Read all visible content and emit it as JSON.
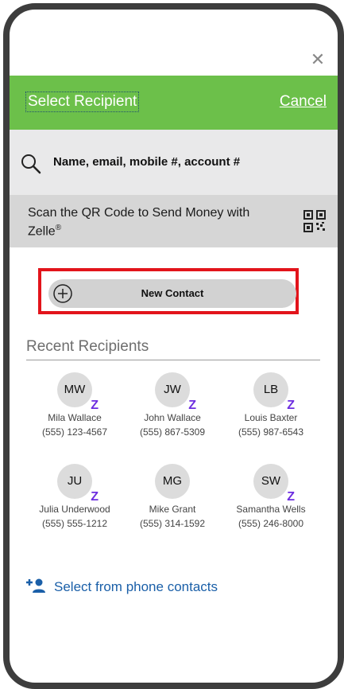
{
  "close_icon": "close-icon",
  "header": {
    "title": "Select Recipient",
    "cancel": "Cancel",
    "color": "#6cc04a"
  },
  "search": {
    "placeholder": "Name, email, mobile #, account #"
  },
  "qr": {
    "text": "Scan the QR Code to Send Money with Zelle",
    "trademark": "®"
  },
  "new_contact": {
    "label": "New Contact"
  },
  "recent": {
    "title": "Recent Recipients",
    "recipients": [
      {
        "initials": "MW",
        "name": "Mila Wallace",
        "phone": "(555) 123-4567"
      },
      {
        "initials": "JW",
        "name": "John Wallace",
        "phone": "(555) 867-5309"
      },
      {
        "initials": "LB",
        "name": "Louis Baxter",
        "phone": "(555) 987-6543"
      },
      {
        "initials": "JU",
        "name": "Julia Underwood",
        "phone": "(555) 555-1212"
      },
      {
        "initials": "MG",
        "name": "Mike Grant",
        "phone": "(555) 314-1592"
      },
      {
        "initials": "SW",
        "name": "Samantha Wells",
        "phone": "(555) 246-8000"
      }
    ]
  },
  "phone_contacts": {
    "label": "Select from phone contacts"
  },
  "colors": {
    "accent_green": "#6cc04a",
    "highlight_red": "#e2141b",
    "zelle_purple": "#6d2ee0",
    "link_blue": "#1a5fa8"
  }
}
